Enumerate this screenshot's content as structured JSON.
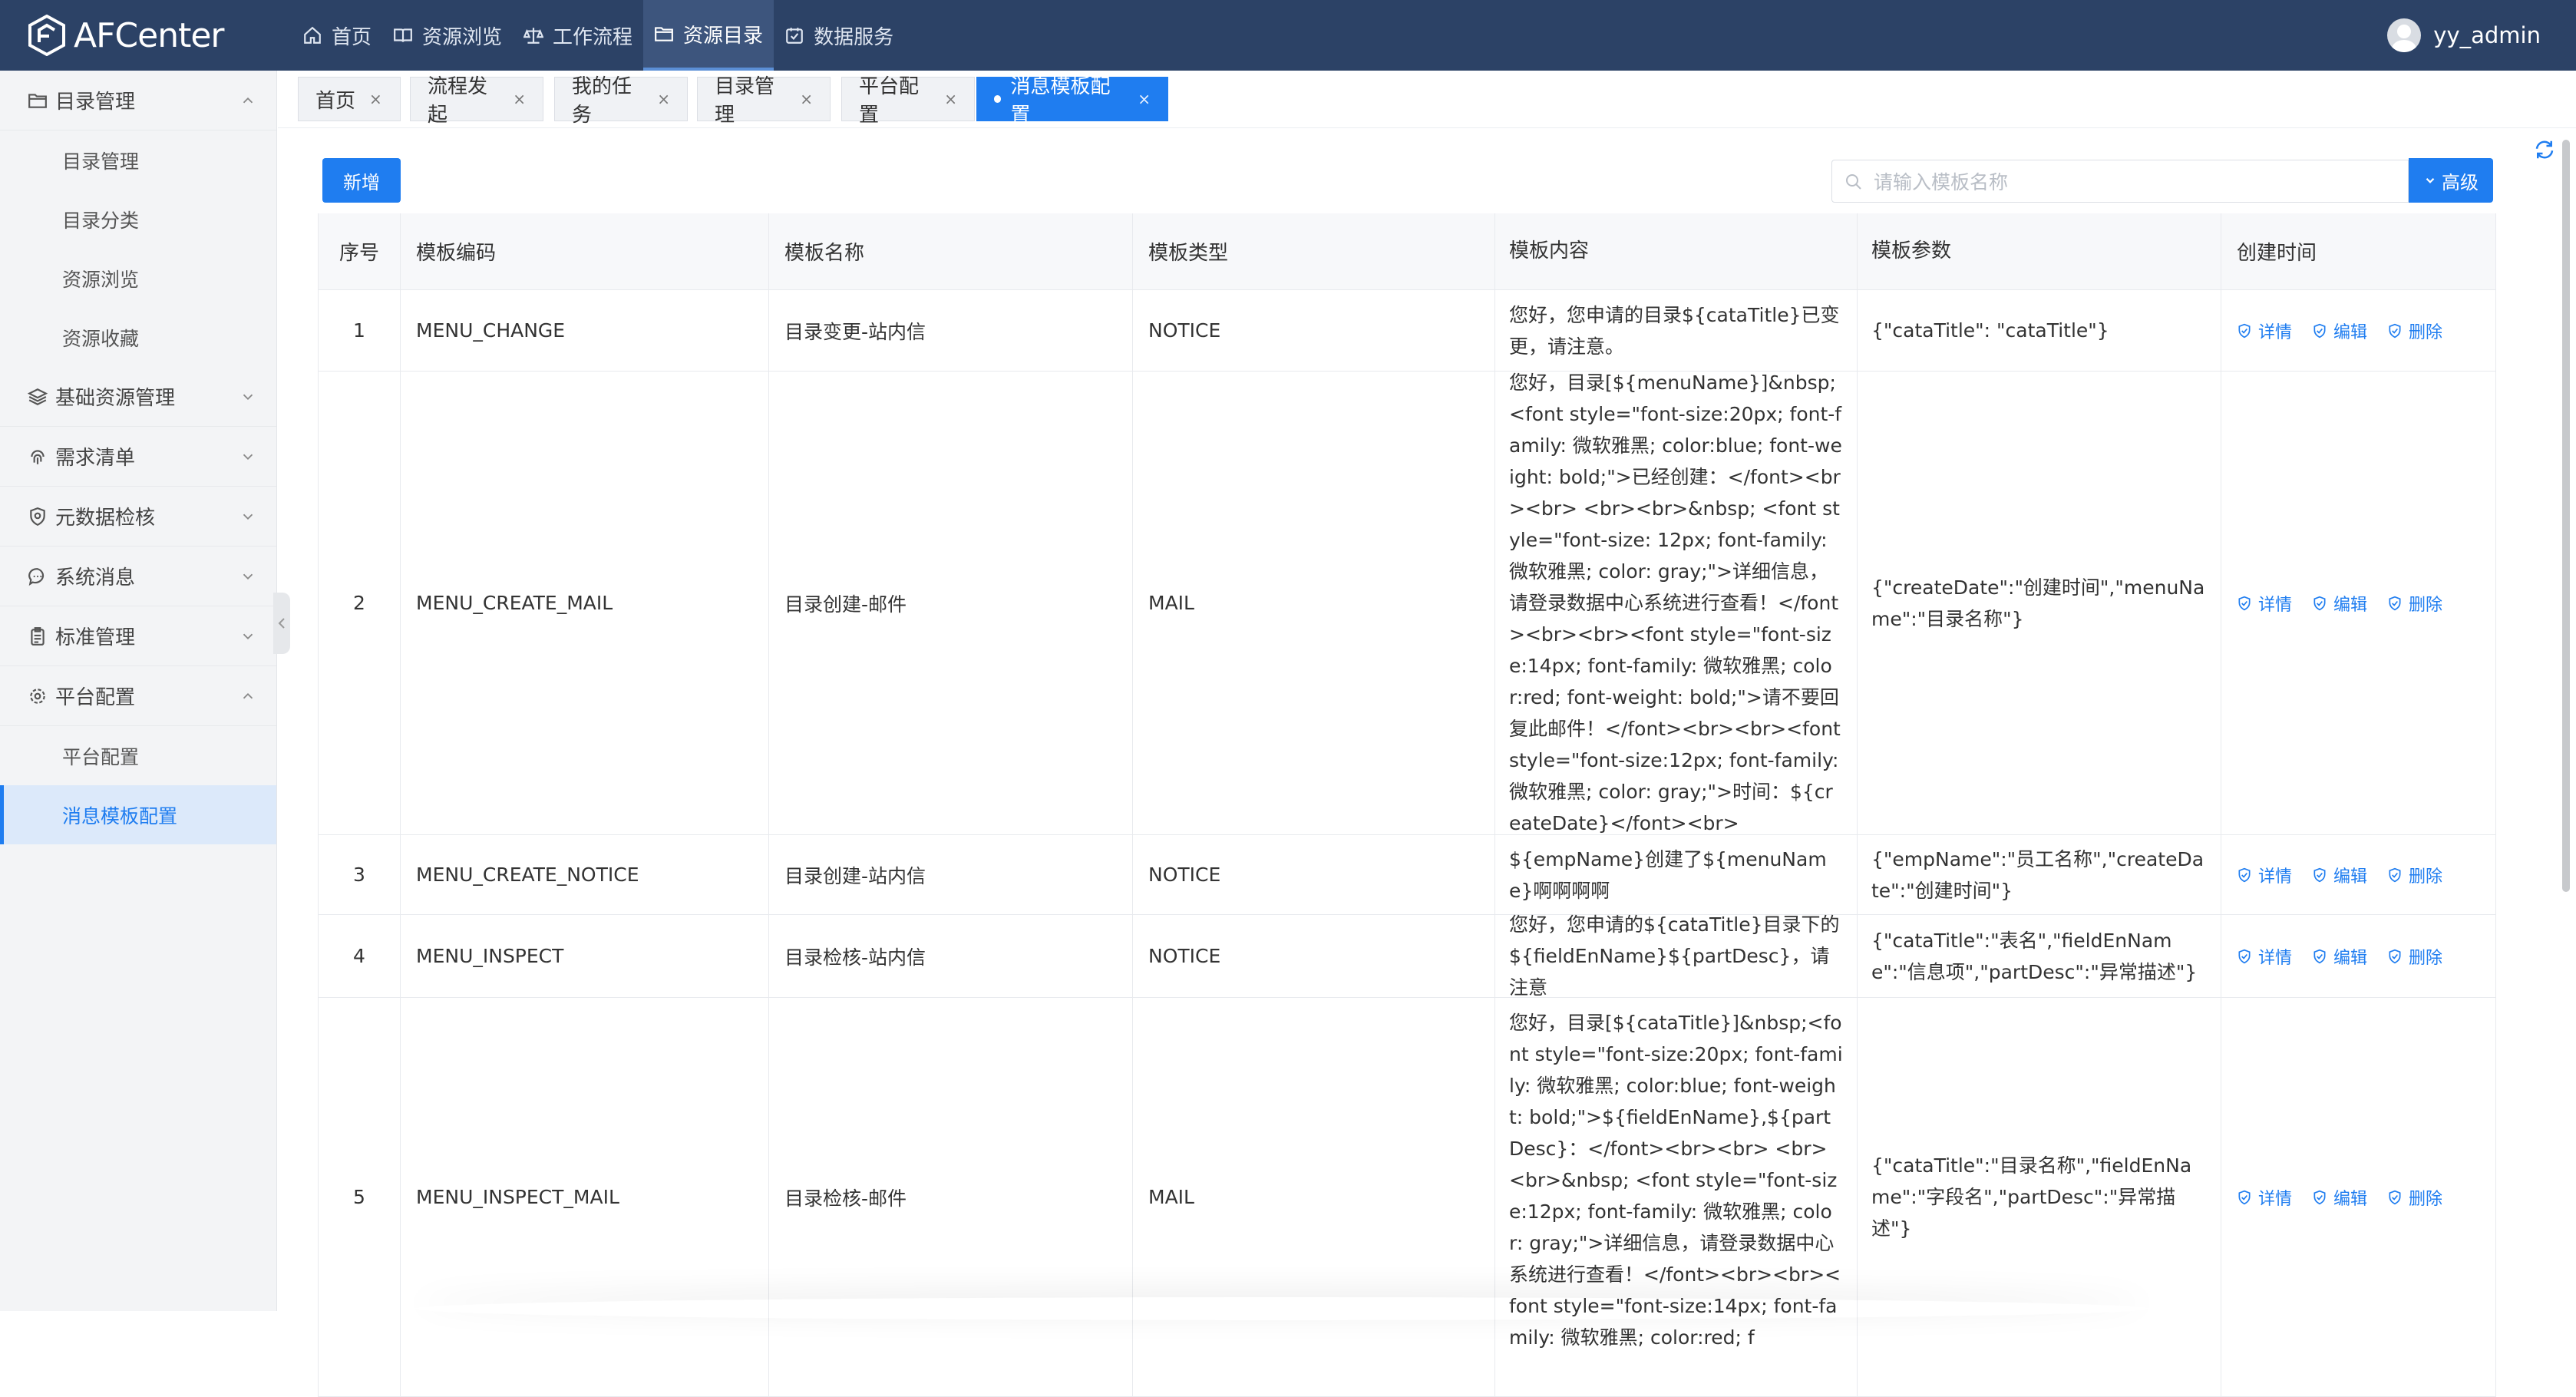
{
  "header": {
    "brand": "AFCenter",
    "nav": [
      {
        "label": "首页",
        "icon": "home-icon"
      },
      {
        "label": "资源浏览",
        "icon": "book-icon"
      },
      {
        "label": "工作流程",
        "icon": "scale-icon"
      },
      {
        "label": "资源目录",
        "icon": "folder-icon",
        "active": true
      },
      {
        "label": "数据服务",
        "icon": "calendar-check-icon"
      }
    ],
    "user": "yy_admin"
  },
  "sidebar": {
    "groups": [
      {
        "label": "目录管理",
        "icon": "folder-icon",
        "expanded": true,
        "items": [
          "目录管理",
          "目录分类",
          "资源浏览",
          "资源收藏"
        ]
      },
      {
        "label": "基础资源管理",
        "icon": "layers-icon",
        "expanded": false
      },
      {
        "label": "需求清单",
        "icon": "fingerprint-icon",
        "expanded": false
      },
      {
        "label": "元数据检核",
        "icon": "shield-icon",
        "expanded": false
      },
      {
        "label": "系统消息",
        "icon": "chat-icon",
        "expanded": false
      },
      {
        "label": "标准管理",
        "icon": "clipboard-icon",
        "expanded": false
      },
      {
        "label": "平台配置",
        "icon": "gear-icon",
        "expanded": true,
        "items": [
          "平台配置",
          "消息模板配置"
        ]
      }
    ],
    "active_item": "消息模板配置"
  },
  "tabs": [
    "首页",
    "流程发起",
    "我的任务",
    "目录管理",
    "平台配置",
    "消息模板配置"
  ],
  "active_tab": "消息模板配置",
  "toolbar": {
    "add_label": "新增",
    "search_placeholder": "请输入模板名称",
    "advanced_label": "高级"
  },
  "table": {
    "headers": [
      "序号",
      "模板编码",
      "模板名称",
      "模板类型",
      "模板内容",
      "模板参数",
      "创建时间"
    ],
    "actions": [
      "详情",
      "编辑",
      "删除"
    ],
    "rows": [
      {
        "no": "1",
        "code": "MENU_CHANGE",
        "name": "目录变更-站内信",
        "type": "NOTICE",
        "content": "您好，您申请的目录${cataTitle}已变更，请注意。",
        "params": "{\"cataTitle\": \"cataTitle\"}"
      },
      {
        "no": "2",
        "code": "MENU_CREATE_MAIL",
        "name": "目录创建-邮件",
        "type": "MAIL",
        "content": "您好，目录[${menuName}]&nbsp;<font style=\"font-size:20px; font-family: 微软雅黑; color:blue; font-weight: bold;\">已经创建：</font><br><br> <br><br>&nbsp; <font style=\"font-size: 12px; font-family: 微软雅黑; color: gray;\">详细信息，请登录数据中心系统进行查看！</font><br><br><font style=\"font-size:14px; font-family: 微软雅黑; color:red; font-weight: bold;\">请不要回复此邮件！</font><br><br><font style=\"font-size:12px; font-family: 微软雅黑; color: gray;\">时间：${createDate}</font><br>",
        "params": "{\"createDate\":\"创建时间\",\"menuName\":\"目录名称\"}"
      },
      {
        "no": "3",
        "code": "MENU_CREATE_NOTICE",
        "name": "目录创建-站内信",
        "type": "NOTICE",
        "content": "${empName}创建了${menuName}啊啊啊啊",
        "params": "{\"empName\":\"员工名称\",\"createDate\":\"创建时间\"}"
      },
      {
        "no": "4",
        "code": "MENU_INSPECT",
        "name": "目录检核-站内信",
        "type": "NOTICE",
        "content": "您好，您申请的${cataTitle}目录下的${fieldEnName}${partDesc}，请注意",
        "params": "{\"cataTitle\":\"表名\",\"fieldEnName\":\"信息项\",\"partDesc\":\"异常描述\"}"
      },
      {
        "no": "5",
        "code": "MENU_INSPECT_MAIL",
        "name": "目录检核-邮件",
        "type": "MAIL",
        "content": "您好，目录[${cataTitle}]&nbsp;<font style=\"font-size:20px; font-family: 微软雅黑; color:blue; font-weight: bold;\">${fieldEnName},${partDesc}：</font><br><br> <br><br>&nbsp; <font style=\"font-size:12px; font-family: 微软雅黑; color: gray;\">详细信息，请登录数据中心系统进行查看！</font><br><br><font style=\"font-size:14px; font-family: 微软雅黑; color:red; f",
        "params": "{\"cataTitle\":\"目录名称\",\"fieldEnName\":\"字段名\",\"partDesc\":\"异常描述\"}"
      }
    ]
  },
  "colors": {
    "header_bg": "#2c4266",
    "primary": "#1f7df0",
    "sidebar_bg": "#f3f4f6",
    "active_item_bg": "#dce9fa"
  }
}
